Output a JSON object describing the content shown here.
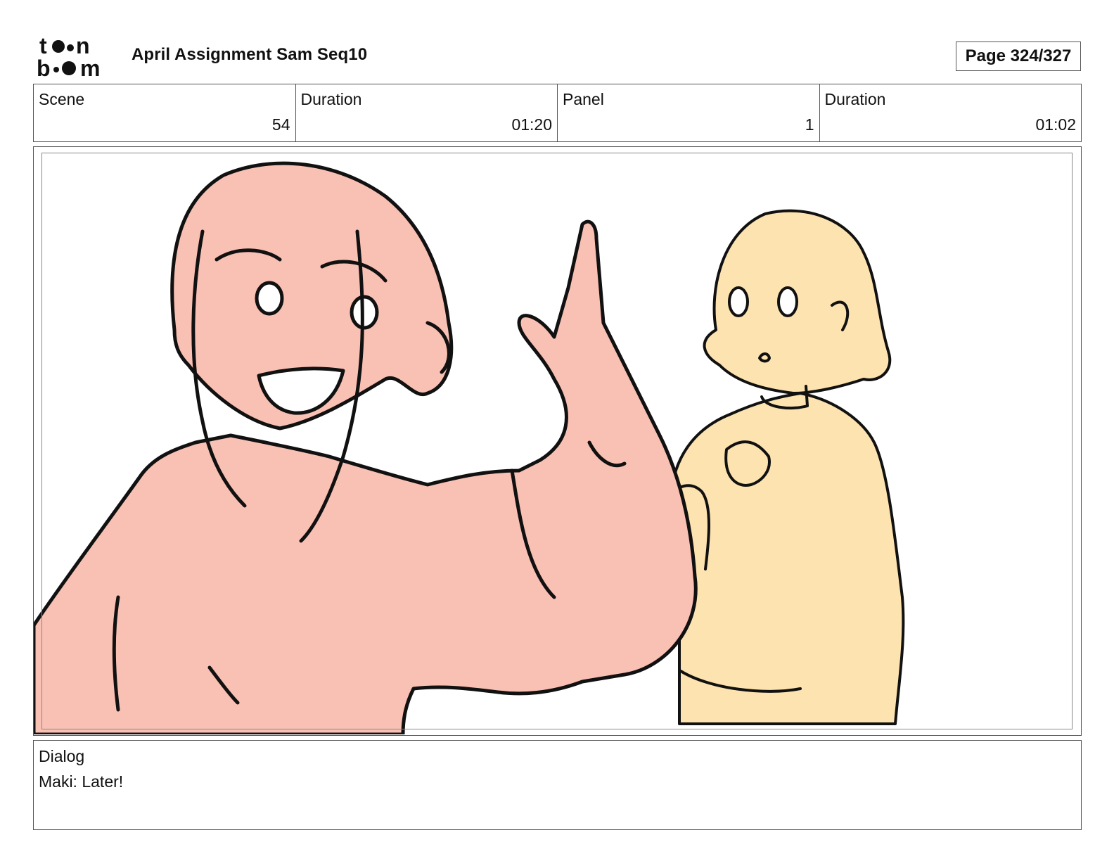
{
  "header": {
    "logo_text_top": "toon",
    "logo_text_bottom": "boom",
    "title": "April Assignment Sam Seq10",
    "page": "Page 324/327"
  },
  "info": [
    {
      "label": "Scene",
      "value": "54"
    },
    {
      "label": "Duration",
      "value": "01:20"
    },
    {
      "label": "Panel",
      "value": "1"
    },
    {
      "label": "Duration",
      "value": "01:02"
    }
  ],
  "dialog": {
    "label": "Dialog",
    "text": "Maki: Later!"
  },
  "colors": {
    "character_left_fill": "#f9c0b4",
    "character_right_fill": "#fce3b0",
    "ink": "#111111"
  }
}
